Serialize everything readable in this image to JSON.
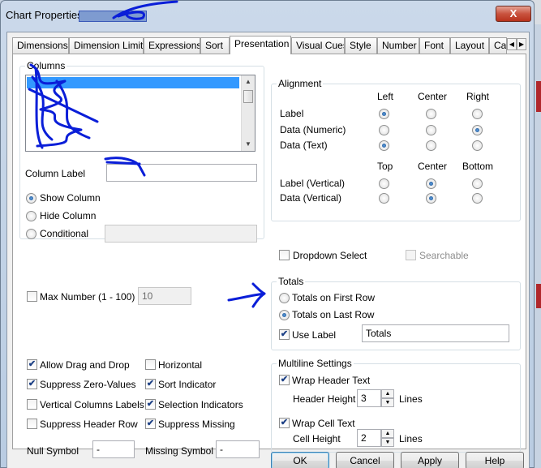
{
  "window": {
    "title": "Chart Properties",
    "close_label": "X"
  },
  "tabs": [
    "Dimensions",
    "Dimension Limits",
    "Expressions",
    "Sort",
    "Presentation",
    "Visual Cues",
    "Style",
    "Number",
    "Font",
    "Layout",
    "Cap"
  ],
  "active_tab": "Presentation",
  "columns": {
    "group_label": "Columns",
    "column_label_label": "Column Label",
    "show_column": "Show Column",
    "hide_column": "Hide Column",
    "conditional": "Conditional",
    "selected": "Show Column"
  },
  "alignment": {
    "group_label": "Alignment",
    "headers": [
      "Left",
      "Center",
      "Right"
    ],
    "rows": [
      {
        "label": "Label",
        "selected": "Left"
      },
      {
        "label": "Data (Numeric)",
        "selected": "Right"
      },
      {
        "label": "Data (Text)",
        "selected": "Left"
      }
    ],
    "vertical_headers": [
      "Top",
      "Center",
      "Bottom"
    ],
    "vertical_rows": [
      {
        "label": "Label (Vertical)",
        "selected": "Center"
      },
      {
        "label": "Data (Vertical)",
        "selected": "Center"
      }
    ]
  },
  "dropdown_select": {
    "label": "Dropdown Select",
    "checked": false
  },
  "searchable": {
    "label": "Searchable",
    "checked": false,
    "enabled": false
  },
  "max_number": {
    "label": "Max Number (1 - 100)",
    "checked": false,
    "value": "10"
  },
  "totals": {
    "group_label": "Totals",
    "first_row": "Totals on First Row",
    "last_row": "Totals on Last Row",
    "selected": "Totals on Last Row",
    "use_label": "Use Label",
    "use_label_checked": true,
    "label_value": "Totals"
  },
  "options_left": [
    {
      "label": "Allow Drag and Drop",
      "checked": true
    },
    {
      "label": "Suppress Zero-Values",
      "checked": true
    },
    {
      "label": "Vertical Columns Labels",
      "checked": false
    },
    {
      "label": "Suppress Header Row",
      "checked": false
    }
  ],
  "options_right": [
    {
      "label": "Horizontal",
      "checked": false
    },
    {
      "label": "Sort Indicator",
      "checked": true
    },
    {
      "label": "Selection Indicators",
      "checked": true
    },
    {
      "label": "Suppress Missing",
      "checked": true
    }
  ],
  "null_symbol": {
    "label": "Null Symbol",
    "value": "-"
  },
  "missing_symbol": {
    "label": "Missing Symbol",
    "value": "-"
  },
  "multiline": {
    "group_label": "Multiline Settings",
    "wrap_header": {
      "label": "Wrap Header Text",
      "checked": true
    },
    "header_height": {
      "label": "Header Height",
      "value": "3",
      "unit": "Lines"
    },
    "wrap_cell": {
      "label": "Wrap Cell Text",
      "checked": true
    },
    "cell_height": {
      "label": "Cell Height",
      "value": "2",
      "unit": "Lines"
    }
  },
  "buttons": {
    "ok": "OK",
    "cancel": "Cancel",
    "apply": "Apply",
    "help": "Help"
  },
  "colors": {
    "annotation": "#0a1ed8",
    "accent": "#3399ff",
    "close": "#c9533f"
  }
}
